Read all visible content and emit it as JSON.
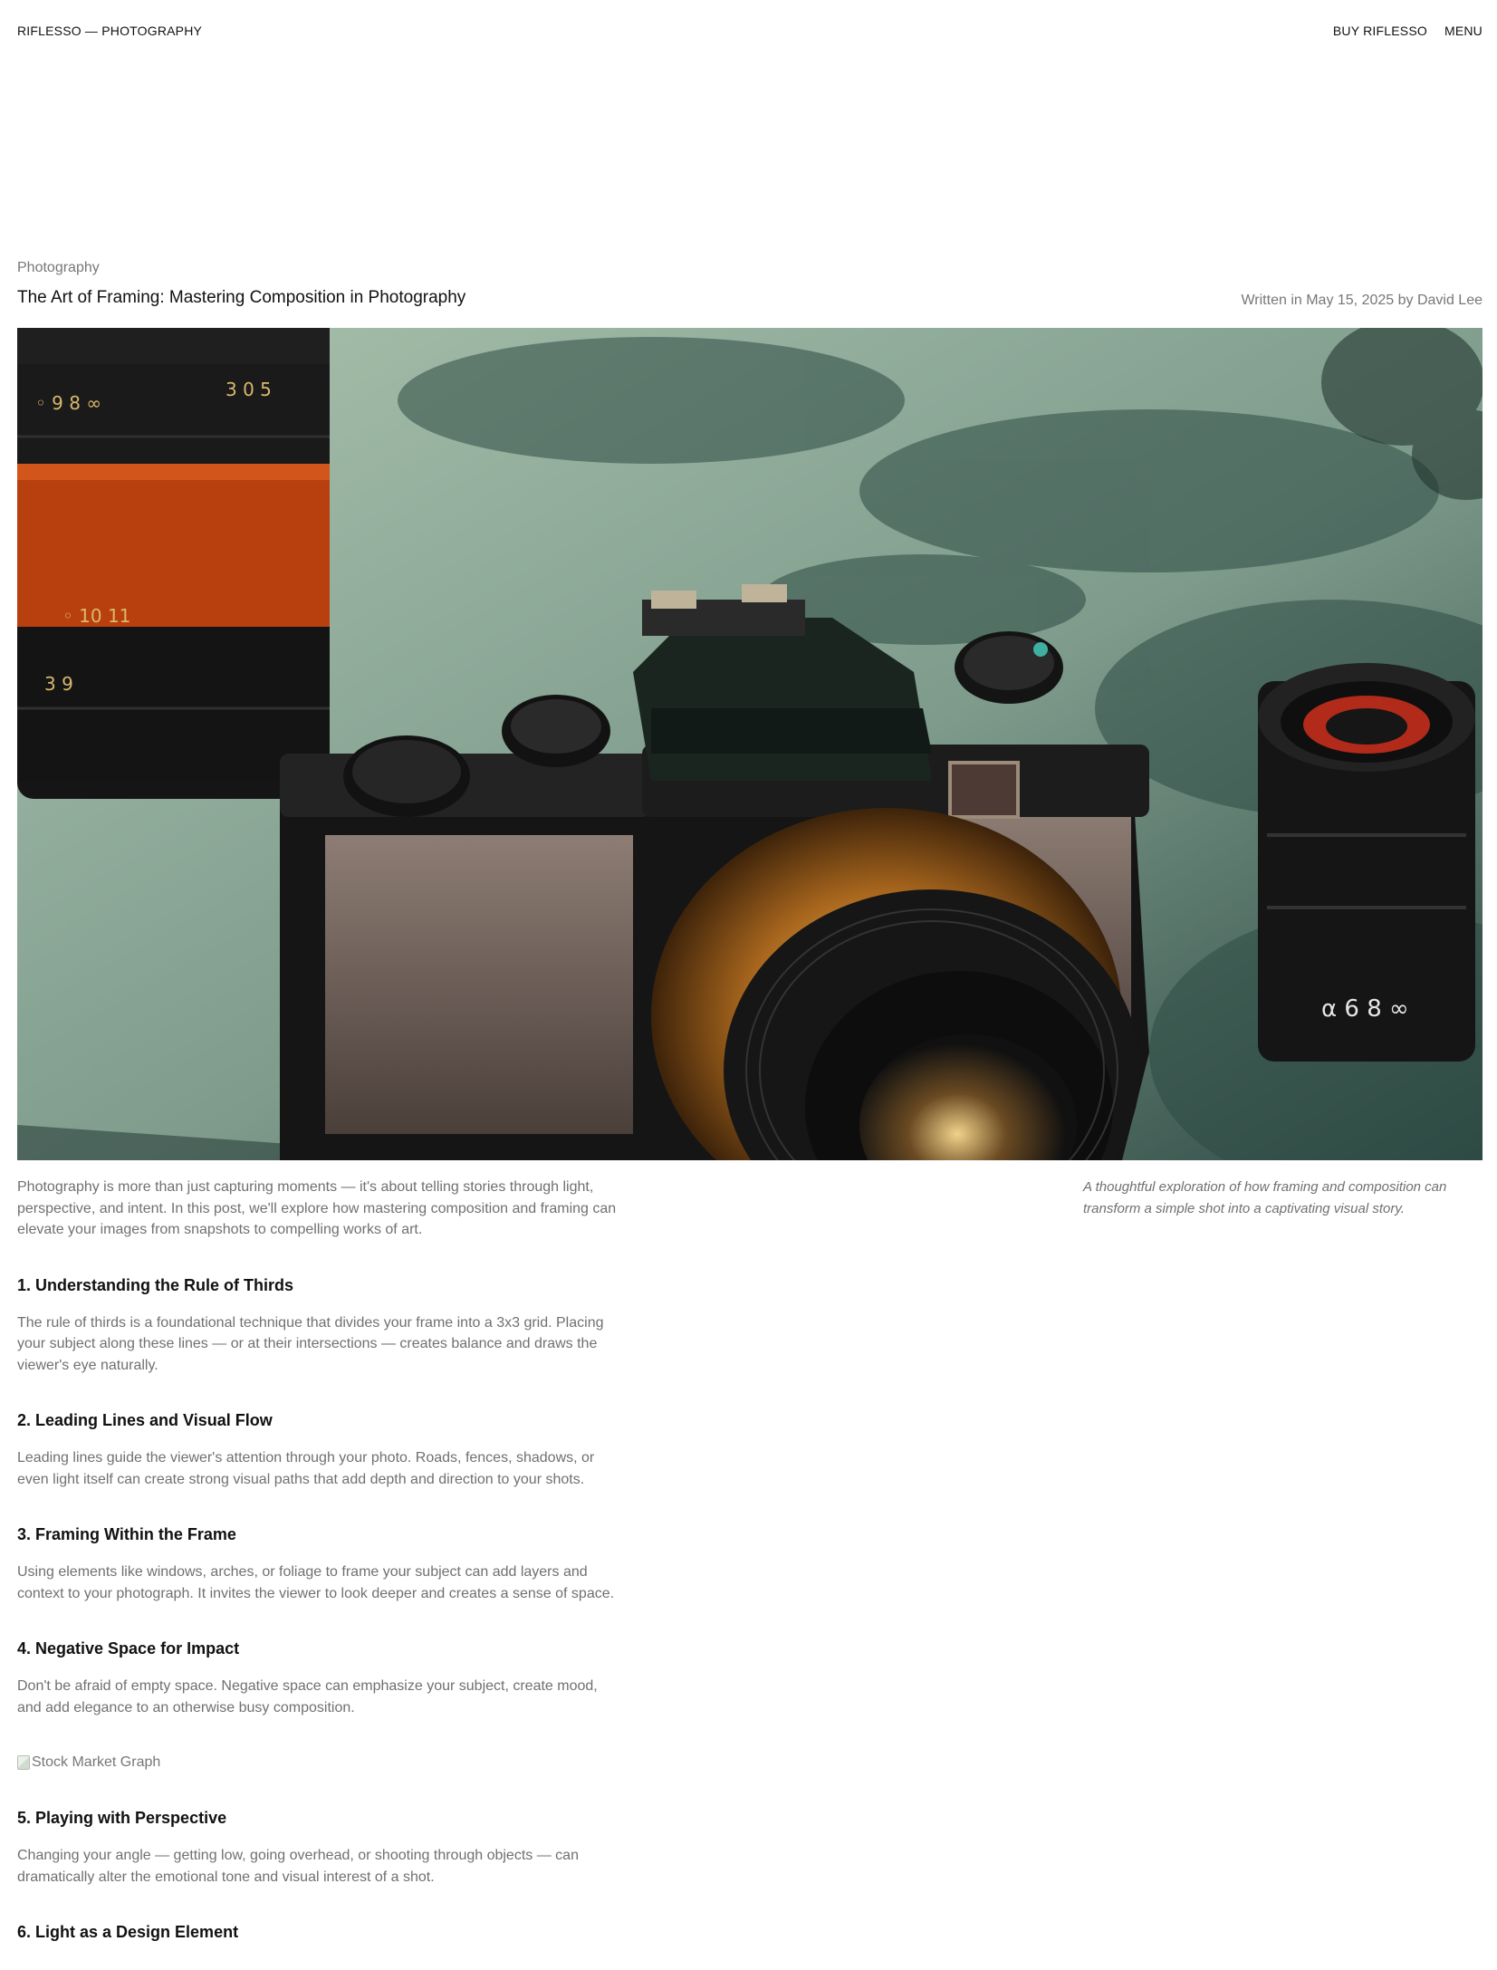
{
  "header": {
    "brand": "RIFLESSO — PHOTOGRAPHY",
    "nav": [
      "BUY RIFLESSO",
      "MENU"
    ]
  },
  "post": {
    "category": "Photography",
    "title": "The Art of Framing: Mastering Composition in Photography",
    "byline": "Written in May 15, 2025 by David Lee",
    "hero_alt": "Vintage film camera with lenses in sunlit shadows",
    "caption": "A thoughtful exploration of how framing and composition can transform a simple shot into a captivating visual story.",
    "intro": "Photography is more than just capturing moments — it's about telling stories through light, perspective, and intent. In this post, we'll explore how mastering composition and framing can elevate your images from snapshots to compelling works of art.",
    "sections": [
      {
        "heading": "1. Understanding the Rule of Thirds",
        "body": "The rule of thirds is a foundational technique that divides your frame into a 3x3 grid. Placing your subject along these lines — or at their intersections — creates balance and draws the viewer's eye naturally."
      },
      {
        "heading": "2. Leading Lines and Visual Flow",
        "body": "Leading lines guide the viewer's attention through your photo. Roads, fences, shadows, or even light itself can create strong visual paths that add depth and direction to your shots."
      },
      {
        "heading": "3. Framing Within the Frame",
        "body": "Using elements like windows, arches, or foliage to frame your subject can add layers and context to your photograph. It invites the viewer to look deeper and creates a sense of space."
      },
      {
        "heading": "4. Negative Space for Impact",
        "body": "Don't be afraid of empty space. Negative space can emphasize your subject, create mood, and add elegance to an otherwise busy composition."
      },
      {
        "heading": "5. Playing with Perspective",
        "body": "Changing your angle — getting low, going overhead, or shooting through objects — can dramatically alter the emotional tone and visual interest of a shot."
      },
      {
        "heading": "6. Light as a Design Element",
        "body": ""
      }
    ],
    "broken_image_alt": "Stock Market Graph"
  }
}
